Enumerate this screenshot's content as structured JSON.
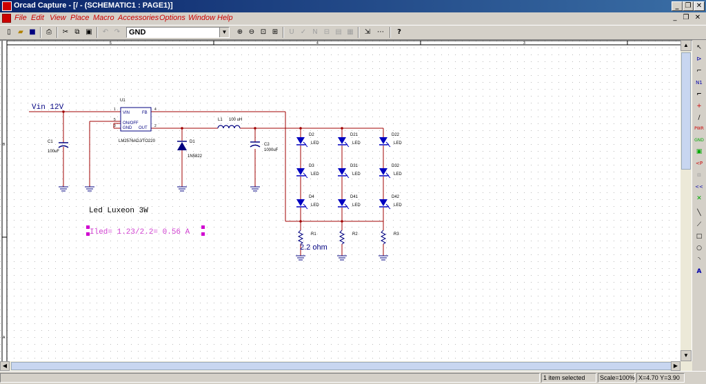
{
  "window": {
    "title": "Orcad Capture - [/ - (SCHEMATIC1 : PAGE1)]"
  },
  "menu": [
    "File",
    "Edit",
    "View",
    "Place",
    "Macro",
    "Accessories",
    "Options",
    "Window",
    "Help"
  ],
  "toolbar": {
    "part_value": "GND"
  },
  "schematic": {
    "vin_label": "Vin 12V",
    "u1": {
      "ref": "U1",
      "part": "LM2576ADJ/TO220",
      "pin_vin": "VIN",
      "pin_fb": "FB",
      "pin_onoff": "ON/OFF",
      "pin_gnd": "GND",
      "pin_out": "OUT",
      "n1": "1",
      "n4": "4",
      "n5": "5",
      "n3": "3",
      "n2": "2"
    },
    "c1": {
      "ref": "C1",
      "value": "100uF"
    },
    "d1": {
      "ref": "D1",
      "value": "1N5822"
    },
    "l1": {
      "ref": "L1",
      "value": "100 uH"
    },
    "c2": {
      "ref": "C2",
      "value": "1000uF"
    },
    "leds": [
      {
        "ref": "D2",
        "value": "LED"
      },
      {
        "ref": "D21",
        "value": "LED"
      },
      {
        "ref": "D22",
        "value": "LED"
      },
      {
        "ref": "D3",
        "value": "LED"
      },
      {
        "ref": "D31",
        "value": "LED"
      },
      {
        "ref": "D32",
        "value": "LED"
      },
      {
        "ref": "D4",
        "value": "LED"
      },
      {
        "ref": "D41",
        "value": "LED"
      },
      {
        "ref": "D42",
        "value": "LED"
      }
    ],
    "r1": {
      "ref": "R1",
      "value": "2.2 ohm"
    },
    "r2": {
      "ref": "R2"
    },
    "r3": {
      "ref": "R3"
    },
    "note1": "Led Luxeon 3W",
    "note2": "Iled= 1.23/2.2= 0.56 A",
    "border_marks": {
      "top": [
        "5",
        "4",
        "3"
      ],
      "left": [
        "B",
        "A"
      ]
    }
  },
  "status": {
    "selection": "1 item selected",
    "scale": "Scale=100%",
    "coords": "X=4.70  Y=3.90"
  }
}
